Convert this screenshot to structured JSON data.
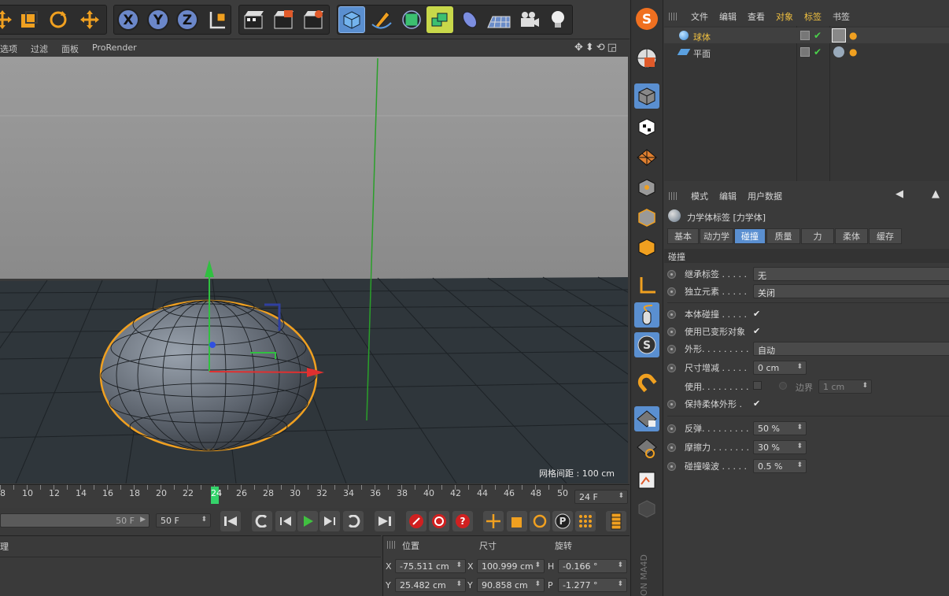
{
  "viewport_menu": [
    "选项",
    "过滤",
    "面板",
    "ProRender"
  ],
  "viewport_status": "网格间距 : 100 cm",
  "timeline": {
    "ruler_labels": [
      "8",
      "10",
      "12",
      "14",
      "16",
      "18",
      "20",
      "22",
      "24",
      "26",
      "28",
      "30",
      "32",
      "34",
      "36",
      "38",
      "40",
      "42",
      "44",
      "46",
      "48",
      "50"
    ],
    "current_frame_field": "24 F",
    "end_frame_slider": "50 F",
    "end_frame_field": "50 F"
  },
  "object_manager": {
    "menu": [
      "文件",
      "编辑",
      "查看",
      "对象",
      "标签",
      "书签"
    ],
    "objects": [
      {
        "name": "球体",
        "selected": true
      },
      {
        "name": "平面",
        "selected": false
      }
    ]
  },
  "attribute_manager": {
    "menu": [
      "模式",
      "编辑",
      "用户数据"
    ],
    "title": "力学体标签 [力学体]",
    "tabs": [
      "基本",
      "动力学",
      "碰撞",
      "质量",
      "力",
      "柔体",
      "缓存"
    ],
    "active_tab": "碰撞",
    "section": "碰撞",
    "rows": {
      "inherit_tag": {
        "label": "继承标签 . . . . .",
        "value": "无"
      },
      "individual": {
        "label": "独立元素 . . . . .",
        "value": "关闭"
      },
      "self_collision": {
        "label": "本体碰撞 . . . . .",
        "checked": true
      },
      "use_deformed": {
        "label": "使用已变形对象",
        "checked": true
      },
      "shape": {
        "label": "外形. . . . . . . . .",
        "value": "自动"
      },
      "size_increment": {
        "label": "尺寸增减 . . . . .",
        "value": "0 cm"
      },
      "use": {
        "label": "使用. . . . . . . . .",
        "border_label": "边界",
        "border_value": "1 cm"
      },
      "keep_soft": {
        "label": "保持柔体外形 .",
        "checked": true
      },
      "bounce": {
        "label": "反弹. . . . . . . . .",
        "value": "50 %"
      },
      "friction": {
        "label": "摩擦力 . . . . . . .",
        "value": "30 %"
      },
      "collision_noise": {
        "label": "碰撞噪波 . . . . .",
        "value": "0.5 %"
      }
    }
  },
  "coordinates": {
    "headers": [
      "位置",
      "尺寸",
      "旋转"
    ],
    "left_label": "理",
    "x": {
      "pos": "-75.511 cm",
      "size": "100.999 cm",
      "rot_axis": "H",
      "rot": "-0.166 °"
    },
    "y": {
      "pos": "25.482 cm",
      "size": "90.858 cm",
      "rot_axis": "P",
      "rot": "-1.277 °"
    }
  },
  "colors": {
    "accent_orange": "#f0a020",
    "active_blue": "#5a8fd0",
    "axis_green": "#30c040",
    "axis_red": "#e03030"
  },
  "icons": [
    "move-icon",
    "scale-icon",
    "rotate-icon",
    "x-axis-icon",
    "y-axis-icon",
    "z-axis-icon",
    "coord-system-icon",
    "render-view-icon",
    "render-picture-icon",
    "render-settings-icon",
    "cube-icon",
    "pen-icon",
    "subdivision-icon",
    "array-icon",
    "deformer-icon",
    "floor-icon",
    "camera-icon",
    "light-icon",
    "scene-logo-icon"
  ]
}
